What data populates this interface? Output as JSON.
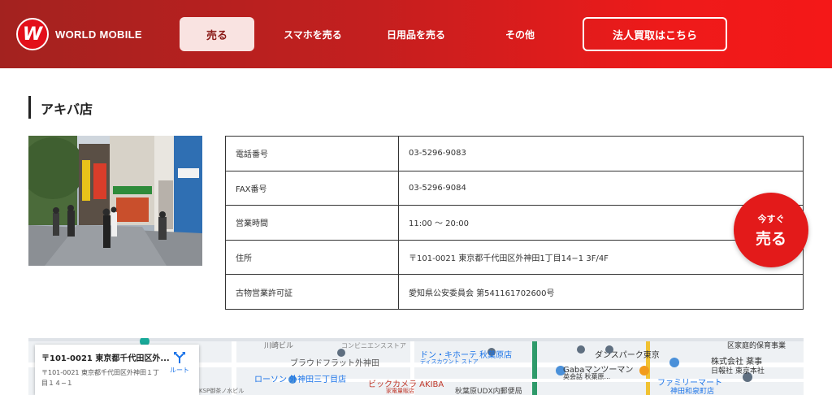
{
  "brand": {
    "logo_letter": "W",
    "name": "WORLD MOBILE",
    "accent": "#e31a1a"
  },
  "nav": {
    "sell": "売る",
    "sell_phone": "スマホを売る",
    "sell_daily": "日用品を売る",
    "other": "その他",
    "corporate": "法人買取はこちら"
  },
  "page": {
    "title": "アキバ店"
  },
  "info": {
    "rows": [
      {
        "label": "電話番号",
        "value": "03-5296-9083"
      },
      {
        "label": "FAX番号",
        "value": "03-5296-9084"
      },
      {
        "label": "営業時間",
        "value": "11:00 〜 20:00"
      },
      {
        "label": "住所",
        "value": "〒101-0021 東京都千代田区外神田1丁目14−1 3F/4F"
      },
      {
        "label": "古物営業許可証",
        "value": "愛知県公安委員会 第541161702600号"
      }
    ]
  },
  "cta": {
    "line1": "今すぐ",
    "line2": "売る"
  },
  "map": {
    "card_title": "〒101-0021 東京都千代田区外...",
    "card_address": "〒101-0021 東京都千代田区外神田１丁目１４−１",
    "route_label": "ルート",
    "labels": [
      "ブラウドフラット外神田",
      "コンビニエンスストア",
      "ドン・キホーテ 秋葉原店",
      "ディスカウント ストア",
      "ダンスパーク東京",
      "Gabaマンツーマン",
      "英会話 秋葉原...",
      "株式会社 薬事",
      "日報社 東京本社",
      "区家庭的保育事業",
      "ファミリーマート",
      "神田和泉町店",
      "ローソン 外神田三丁目店",
      "ビックカメラ AKIBA",
      "家電量販店",
      "秋葉原UDX内郵便局",
      "川崎ビル",
      "KSP御茶ノ水ビル"
    ]
  }
}
